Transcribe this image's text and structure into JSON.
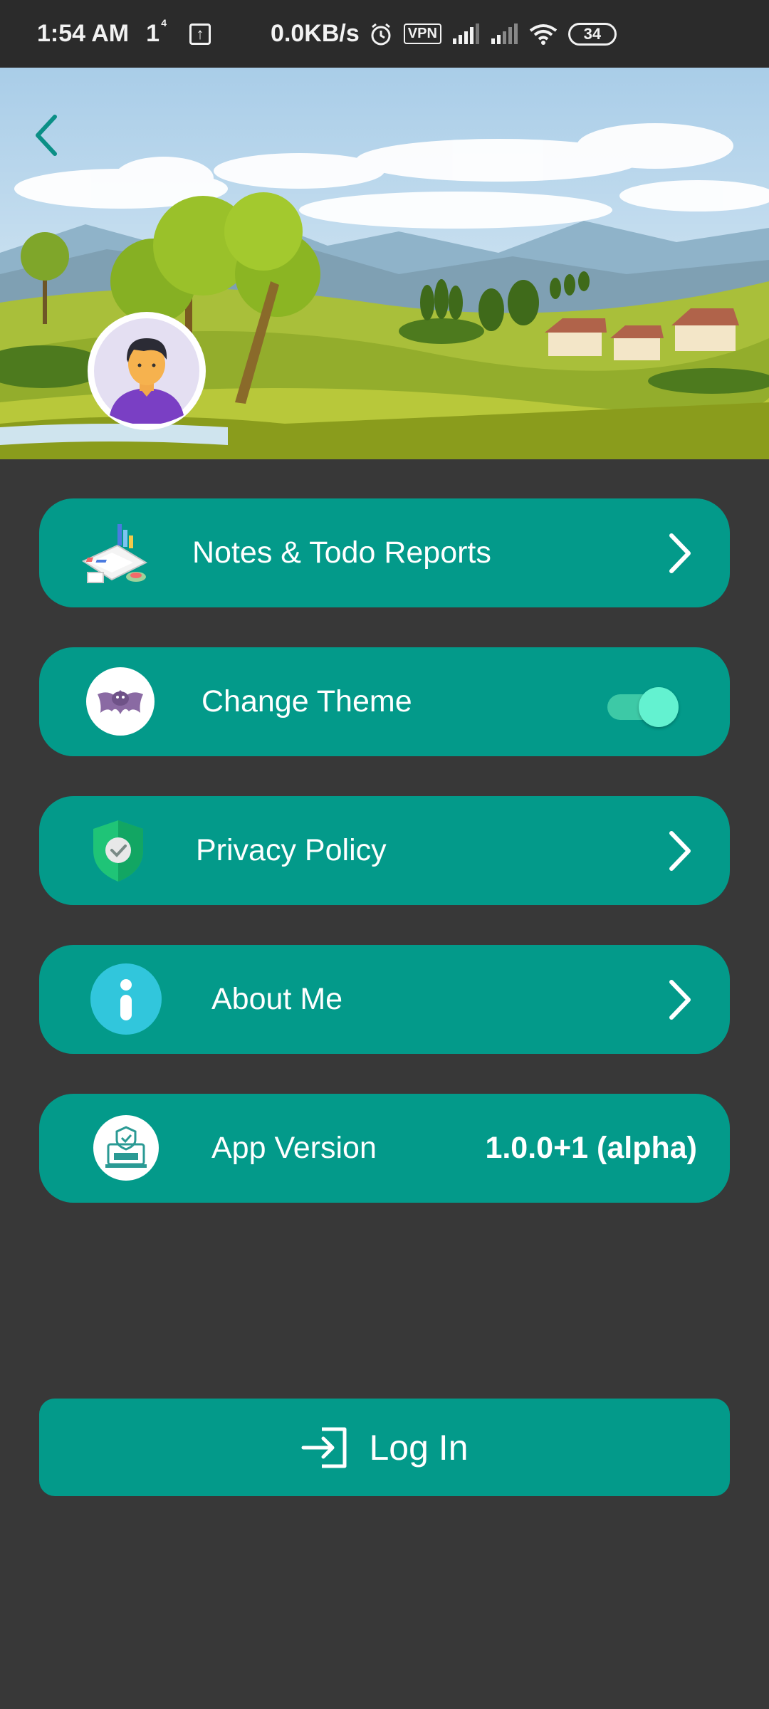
{
  "status_bar": {
    "time": "1:54 AM",
    "indicator": "1",
    "indicator_sup": "4",
    "net_speed": "0.0KB/s",
    "vpn": "VPN",
    "battery": "34"
  },
  "header": {
    "back_icon": "chevron-left-icon",
    "avatar_icon": "user-avatar-icon"
  },
  "menu": {
    "reports": {
      "label": "Notes & Todo Reports",
      "icon": "reports-icon"
    },
    "theme": {
      "label": "Change Theme",
      "icon": "bat-icon",
      "toggle_on": true
    },
    "privacy": {
      "label": "Privacy Policy",
      "icon": "shield-check-icon"
    },
    "about": {
      "label": "About Me",
      "icon": "info-icon"
    },
    "version": {
      "label": "App Version",
      "value": "1.0.0+1 (alpha)",
      "icon": "beta-badge-icon"
    }
  },
  "login": {
    "label": "Log In",
    "icon": "login-icon"
  },
  "colors": {
    "background": "#383838",
    "card": "#039a8a",
    "status_bar": "#2b2b2b",
    "toggle_thumb": "#63f2d0"
  }
}
